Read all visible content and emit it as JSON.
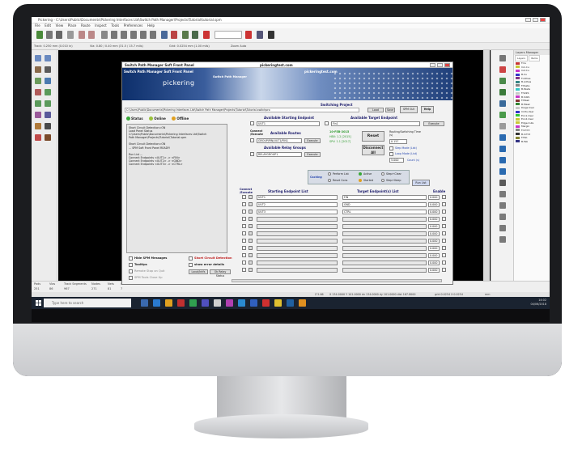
{
  "window": {
    "title": "Pickering - C:\\Users\\Public\\Documents\\Pickering Interfaces Ltd\\Switch Path Manager\\Projects\\Tutorial\\tutorial.spm"
  },
  "menu": [
    "File",
    "Edit",
    "View",
    "Place",
    "Route",
    "Inspect",
    "Tools",
    "Preferences",
    "Help"
  ],
  "toolbar2": {
    "track": "Track: 0.250 mm (0.010 in)",
    "via": "Via: 0.80 / 0.40 mm (31.5 / 15.7 mils)",
    "grid": "Grid: 0.0254 mm (1.00 mils)",
    "zoom": "Zoom Auto"
  },
  "panel": {
    "title": "Switch Path Manager Soft Front Panel",
    "site": "pickeringtest.com",
    "banner_title": "Switch Path Manager Soft Front Panel",
    "logo": "pickering",
    "subtitle": "Switch Path Manager",
    "url": "pickeringtest.com",
    "section_title": "Switching Project",
    "path": "C:\\Users\\Public\\Documents\\Pickering Interfaces Ltd\\Switch Path Manager\\Projects\\Tutorial\\Tutorial.switchpro",
    "btn_load": "Load",
    "btn_save": "Save",
    "btn_spm": "SPM GUI",
    "btn_help": "Help",
    "status_labels": [
      "Status",
      "Online",
      "Offline"
    ],
    "messages": "Short Circuit Detection=ON\nLoad Panel Status\nC:\\Users\\Public\\Documents\\Pickering Interfaces Ltd\\Switch\nPath Manager\\Projects\\Tutorial\\Tutorial.spm\n\nShort Circuit Detection=ON\n... SPM Soft Front Panel READY!\n\nRun List ...\nConnect Endpoints <UUT1> -> <FIN>\nConnect Endpoints <UUT2> -> <GND>\nConnect Endpoints <UUT3> -> <CTRL>",
    "avail_start_hdr": "Available Starting Endpoint",
    "avail_target_hdr": "Available Target Endpoint",
    "start_value": "UUT1",
    "target_value": "Fin1",
    "btn_execute": "Execute",
    "connect_routes": "Connect\n/Execute",
    "avail_routes_hdr": "Available Routes",
    "route_value": "GROUP/PIN/UUT1/FIN1",
    "avail_relay_hdr": "Available Relay Groups",
    "relay_value": "RELAYGROUP1",
    "hw_status": [
      "10-FEB-2015",
      "HBV: 1.2 [2015]",
      "SPV: 1.1 [2017]"
    ],
    "btn_reset": "Reset",
    "btn_disconnect": "Disconnect All",
    "routing_label": "Routing/Switching Time (s)",
    "routing_value": "0.157",
    "chk_step": "Step Mode (List)",
    "chk_loop": "Loop Mode (List)",
    "loop_value": "5.000",
    "count_label": "Count (s)",
    "caching_label": "Caching",
    "cache_opts": [
      "Perform List",
      "Active",
      "Step+Clear",
      "Reset Cons",
      "Started",
      "Step+Keep"
    ],
    "btn_run": "Run List",
    "tbl_connect": "Connect\n/Execute",
    "tbl_start": "Starting Endpoint List",
    "tbl_target": "Target Endpoint(s) List",
    "tbl_enable": "Enable",
    "rows": [
      {
        "start": "UUT1",
        "target": "FIN",
        "time": "0.000"
      },
      {
        "start": "UUT2",
        "target": "GND",
        "time": "0.000"
      },
      {
        "start": "UUT3",
        "target": "CTRL",
        "time": "0.000"
      },
      {
        "start": "",
        "target": "",
        "time": "0.000"
      },
      {
        "start": "",
        "target": "",
        "time": "0.000"
      },
      {
        "start": "",
        "target": "",
        "time": "0.000"
      },
      {
        "start": "",
        "target": "",
        "time": "0.000"
      },
      {
        "start": "",
        "target": "",
        "time": "0.000"
      },
      {
        "start": "",
        "target": "",
        "time": "0.000"
      },
      {
        "start": "",
        "target": "",
        "time": "0.000"
      },
      {
        "start": "",
        "target": "",
        "time": "0.000"
      }
    ],
    "opt_hide": "Hide SPM Messages",
    "opt_tooltips": "Tooltips",
    "opt_remote": "Remote Stop on Quit",
    "opt_spm_tools": "SPM Tools Close Up",
    "opt_short": "Short Circuit Detection",
    "opt_error": "show error details",
    "btn_local": "Local/Intfs",
    "btn_relays": "Ok Relay Status"
  },
  "layers": {
    "header": "Layers Manager",
    "tabs": [
      "Layers",
      "Items"
    ],
    "items": [
      {
        "name": "F.Cu",
        "color": "#c83434"
      },
      {
        "name": "In1.Cu",
        "color": "#c8c834"
      },
      {
        "name": "In2.Cu",
        "color": "#c834c8"
      },
      {
        "name": "B.Cu",
        "color": "#3434c8"
      },
      {
        "name": "F.Adhes",
        "color": "#843484"
      },
      {
        "name": "B.Adhes",
        "color": "#348484"
      },
      {
        "name": "F.Paste",
        "color": "#848484"
      },
      {
        "name": "B.Paste",
        "color": "#34c8c8"
      },
      {
        "name": "F.SilkS",
        "color": "#c8c8c8"
      },
      {
        "name": "B.SilkS",
        "color": "#c834c8"
      },
      {
        "name": "F.Mask",
        "color": "#843434"
      },
      {
        "name": "B.Mask",
        "color": "#348434"
      },
      {
        "name": "Dwgs.User",
        "color": "#c8c8c8"
      },
      {
        "name": "Cmts.User",
        "color": "#3434c8"
      },
      {
        "name": "Eco1.User",
        "color": "#34c834"
      },
      {
        "name": "Eco2.User",
        "color": "#c8c834"
      },
      {
        "name": "Edge.Cuts",
        "color": "#c8c834"
      },
      {
        "name": "Margin",
        "color": "#c834c8"
      },
      {
        "name": "F.CrtYd",
        "color": "#848484"
      },
      {
        "name": "B.CrtYd",
        "color": "#343434"
      },
      {
        "name": "F.Fab",
        "color": "#848434"
      },
      {
        "name": "B.Fab",
        "color": "#343484"
      }
    ]
  },
  "statusbar": {
    "pads": "Pads",
    "pads_v": "251",
    "vias": "Vias",
    "vias_v": "86",
    "track": "Track Segments",
    "track_v": "967",
    "nodes": "Nodes",
    "nodes_v": "271",
    "nets": "Nets",
    "nets_v": "81",
    "unrouted": "Unrouted",
    "unrouted_v": "7",
    "zoom": "Z 5.66",
    "coords": "X 134.0000  Y 101.0000   dx 134.0000  dy 101.0000  dist 167.8000",
    "grid": "grid 0.0254 X 0.0254",
    "mm": "mm"
  },
  "taskbar": {
    "search": "Type here to search",
    "time": "14:02",
    "date": "04/06/2018"
  }
}
